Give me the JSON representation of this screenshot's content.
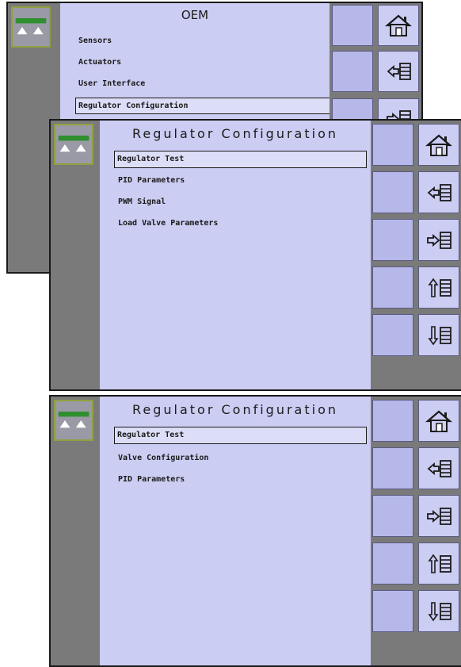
{
  "screens": [
    {
      "title": "OEM",
      "items": [
        "Sensors",
        "Actuators",
        "User Interface",
        "Regulator Configuration"
      ],
      "selected_index": 3
    },
    {
      "title": "Regulator Configuration",
      "items": [
        "Regulator Test",
        "PID Parameters",
        "PWM Signal",
        "Load Valve Parameters"
      ],
      "selected_index": 0
    },
    {
      "title": "Regulator Configuration",
      "items": [
        "Regulator Test",
        "Valve Configuration",
        "PID Parameters"
      ],
      "selected_index": 0
    }
  ],
  "icons": {
    "logo": "spray-boom-logo-icon",
    "home": "home-icon",
    "back": "back-arrow-icon",
    "forward": "forward-arrow-icon",
    "up": "scroll-up-icon",
    "down": "scroll-down-icon"
  },
  "colors": {
    "content_bg": "#cccdf2",
    "softkey_bg": "#b6b8ea",
    "frame_gray": "#7a7a7a",
    "logo_green": "#3a9a3a"
  }
}
